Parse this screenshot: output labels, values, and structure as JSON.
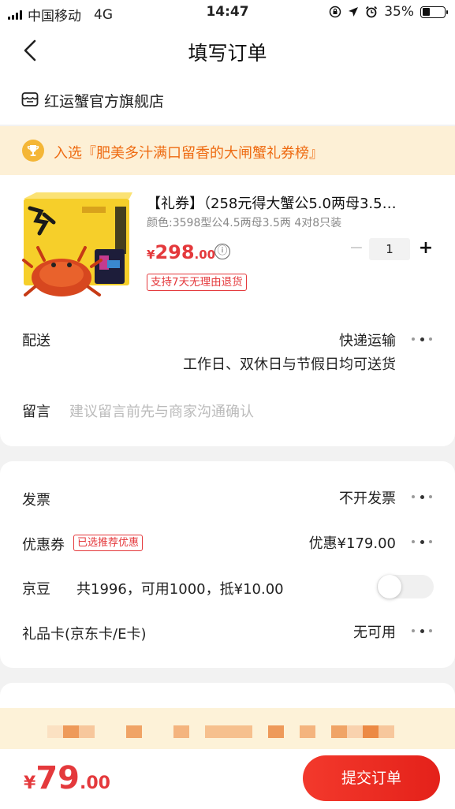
{
  "status_bar": {
    "carrier": "中国移动",
    "network": "4G",
    "time": "14:47",
    "battery_percent": "35%",
    "battery_level": 0.35
  },
  "nav": {
    "title": "填写订单",
    "back_icon": "chevron-left-icon"
  },
  "shop": {
    "icon": "store-icon",
    "name": "红运蟹官方旗舰店"
  },
  "banner": {
    "icon": "trophy-icon",
    "text": "入选『肥美多汁满口留香的大闸蟹礼券榜』"
  },
  "product": {
    "title": "【礼券】（258元得大蟹公5.0两母3.5…",
    "spec": "颜色:3598型公4.5两母3.5两 4对8只装",
    "price_currency": "¥",
    "price_integer": "298",
    "price_decimal": ".00",
    "info_icon": "ⓘ",
    "quantity": "1",
    "minus": "−",
    "plus": "+",
    "return_policy": "支持7天无理由退货"
  },
  "delivery": {
    "label": "配送",
    "method": "快递运输",
    "schedule": "工作日、双休日与节假日均可送货"
  },
  "message": {
    "label": "留言",
    "placeholder": "建议留言前先与商家沟通确认"
  },
  "invoice": {
    "label": "发票",
    "value": "不开发票"
  },
  "coupon": {
    "label": "优惠券",
    "tag": "已选推荐优惠",
    "value": "优惠¥179.00"
  },
  "jingdou": {
    "label": "京豆",
    "detail": "共1996，可用1000，抵¥10.00",
    "toggle_on": false
  },
  "gift_card": {
    "label": "礼品卡(京东卡/E卡)",
    "value": "无可用"
  },
  "footer": {
    "total_currency": "¥",
    "total_integer": "79",
    "total_decimal": ".00",
    "submit_label": "提交订单"
  },
  "colors": {
    "accent_red": "#e4393c",
    "banner_bg": "#fdf0d6",
    "banner_text": "#ee6b12"
  }
}
